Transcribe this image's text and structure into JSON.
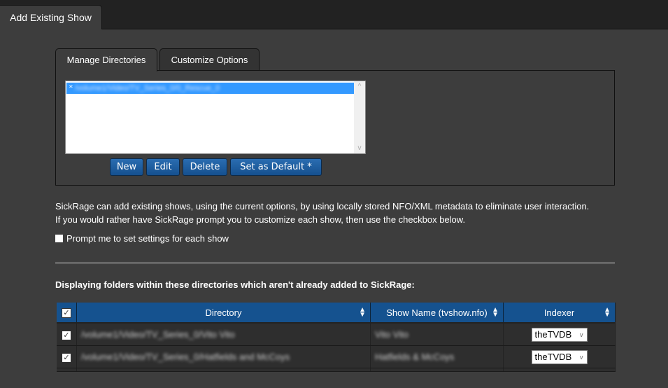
{
  "header": {
    "tab_label": "Add Existing Show"
  },
  "subtabs": [
    {
      "label": "Manage Directories",
      "active": true
    },
    {
      "label": "Customize Options",
      "active": false
    }
  ],
  "root_dirs": {
    "items": [
      {
        "marker": "*",
        "path": "/volume1/Video/TV_Series_0/0_Rescue_0",
        "selected": true
      }
    ],
    "buttons": {
      "new": "New",
      "edit": "Edit",
      "delete": "Delete",
      "set_default": "Set as Default *"
    }
  },
  "description": {
    "line1": "SickRage can add existing shows, using the current options, by using locally stored NFO/XML metadata to eliminate user interaction.",
    "line2": "If you would rather have SickRage prompt you to customize each show, then use the checkbox below."
  },
  "prompt_checkbox": {
    "label": "Prompt me to set settings for each show",
    "checked": false
  },
  "folders_title": "Displaying folders within these directories which aren't already added to SickRage:",
  "table": {
    "columns": [
      "Directory",
      "Show Name (tvshow.nfo)",
      "Indexer"
    ],
    "select_all_checked": true,
    "rows": [
      {
        "checked": true,
        "directory": "/volume1/Video/TV_Series_0/Vito Vito",
        "show_name": "Vito Vito",
        "indexer": "theTVDB"
      },
      {
        "checked": true,
        "directory": "/volume1/Video/TV_Series_0/Hatfields and McCoys",
        "show_name": "Hatfields & McCoys",
        "indexer": "theTVDB"
      }
    ]
  },
  "icons": {
    "check": "✓",
    "sort": "⇕",
    "chevron_down": "v",
    "scroll_up": "^",
    "scroll_down": "v"
  },
  "colors": {
    "accent": "#15528f",
    "selection": "#3399ff",
    "background": "#3d3d3d",
    "topbar": "#222222"
  }
}
